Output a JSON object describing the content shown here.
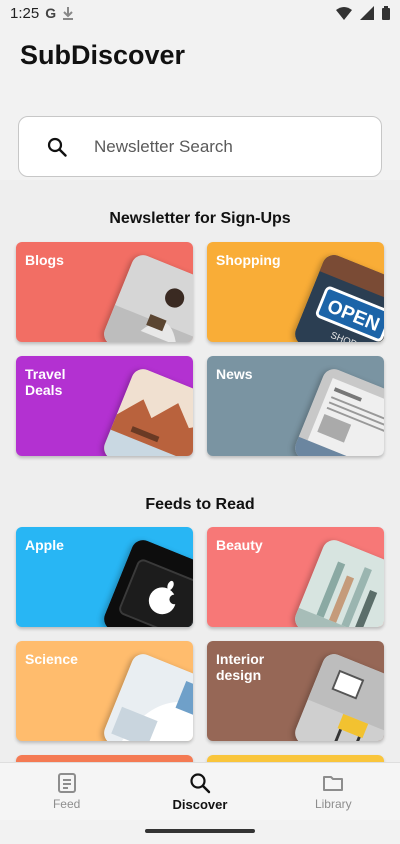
{
  "status_bar": {
    "time": "1:25",
    "g_glyph": "G",
    "icons": [
      "download-icon",
      "wifi-icon",
      "signal-icon",
      "battery-icon"
    ]
  },
  "app": {
    "title": "SubDiscover"
  },
  "search": {
    "placeholder": "Newsletter Search",
    "value": ""
  },
  "sections": [
    {
      "title": "Newsletter for Sign-Ups",
      "cards": [
        {
          "label": "Blogs",
          "color": "#f26e64"
        },
        {
          "label": "Shopping",
          "color": "#f9ad37"
        },
        {
          "label": "Travel Deals",
          "color": "#b331d1"
        },
        {
          "label": "News",
          "color": "#7a94a2"
        }
      ]
    },
    {
      "title": "Feeds to Read",
      "cards": [
        {
          "label": "Apple",
          "color": "#28b6f4"
        },
        {
          "label": "Beauty",
          "color": "#f77877"
        },
        {
          "label": "Science",
          "color": "#ffbc6d"
        },
        {
          "label": "Interior design",
          "color": "#966756"
        },
        {
          "label": "",
          "color": "#f47a53"
        },
        {
          "label": "",
          "color": "#f9c53b"
        }
      ]
    }
  ],
  "card_art_texts": {
    "open_sign": "OPEN",
    "shop_sign": "SHOP"
  },
  "bottom_nav": [
    {
      "label": "Feed",
      "icon": "feed-icon",
      "active": false
    },
    {
      "label": "Discover",
      "icon": "search-icon",
      "active": true
    },
    {
      "label": "Library",
      "icon": "folder-icon",
      "active": false
    }
  ]
}
